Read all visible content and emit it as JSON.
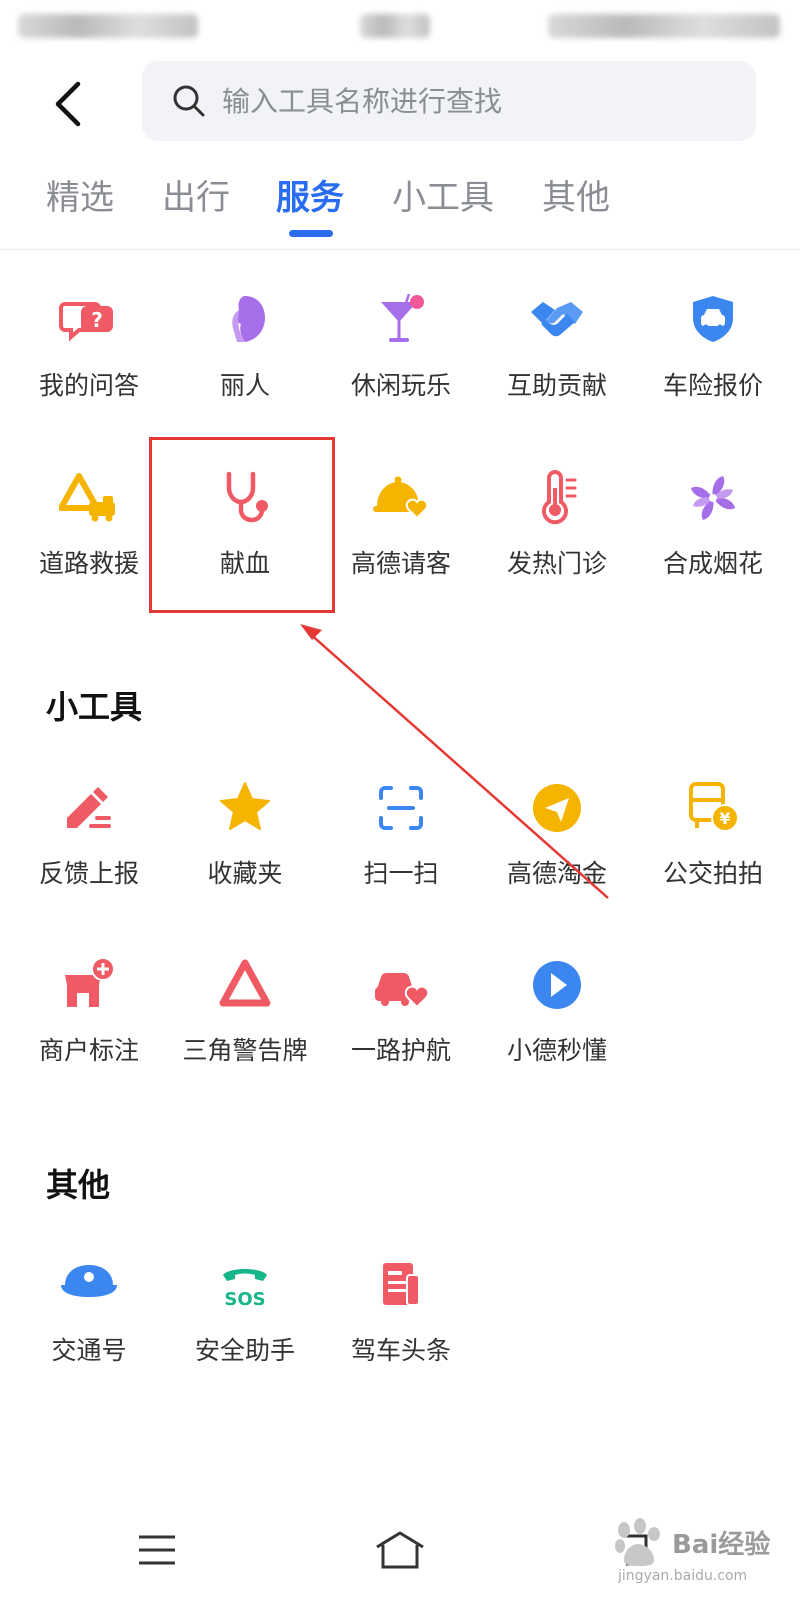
{
  "header": {
    "search_placeholder": "输入工具名称进行查找"
  },
  "tabs": [
    {
      "label": "精选"
    },
    {
      "label": "出行"
    },
    {
      "label": "服务",
      "active": true
    },
    {
      "label": "小工具"
    },
    {
      "label": "其他"
    }
  ],
  "services": [
    {
      "label": "我的问答",
      "icon": "qa-bubble-icon",
      "color": "#f05a64"
    },
    {
      "label": "丽人",
      "icon": "beauty-profile-icon",
      "color": "#a66ee8"
    },
    {
      "label": "休闲玩乐",
      "icon": "cocktail-icon",
      "color": "#a66ee8"
    },
    {
      "label": "互助贡献",
      "icon": "handshake-icon",
      "color": "#3c86f0"
    },
    {
      "label": "车险报价",
      "icon": "car-shield-icon",
      "color": "#3c86f0"
    },
    {
      "label": "道路救援",
      "icon": "roadside-rescue-icon",
      "color": "#f5b400"
    },
    {
      "label": "献血",
      "icon": "stethoscope-icon",
      "color": "#f05a64"
    },
    {
      "label": "高德请客",
      "icon": "food-cloche-heart-icon",
      "color": "#f5b400"
    },
    {
      "label": "发热门诊",
      "icon": "thermometer-icon",
      "color": "#f05a64"
    },
    {
      "label": "合成烟花",
      "icon": "pinwheel-icon",
      "color": "#a66ee8"
    }
  ],
  "tools": {
    "title": "小工具",
    "items": [
      {
        "label": "反馈上报",
        "icon": "pencil-edit-icon",
        "color": "#f05a64"
      },
      {
        "label": "收藏夹",
        "icon": "star-icon",
        "color": "#f5b400"
      },
      {
        "label": "扫一扫",
        "icon": "scan-icon",
        "color": "#3c86f0"
      },
      {
        "label": "高德淘金",
        "icon": "paper-plane-icon",
        "color": "#f5b400"
      },
      {
        "label": "公交拍拍",
        "icon": "bus-coin-icon",
        "color": "#f5b400"
      },
      {
        "label": "商户标注",
        "icon": "shop-plus-icon",
        "color": "#f05a64"
      },
      {
        "label": "三角警告牌",
        "icon": "warning-triangle-icon",
        "color": "#f05a64"
      },
      {
        "label": "一路护航",
        "icon": "car-heart-icon",
        "color": "#f05a64"
      },
      {
        "label": "小德秒懂",
        "icon": "play-circle-icon",
        "color": "#3c86f0"
      }
    ]
  },
  "others": {
    "title": "其他",
    "items": [
      {
        "label": "交通号",
        "icon": "police-cap-icon",
        "color": "#3c86f0"
      },
      {
        "label": "安全助手",
        "icon": "sos-phone-icon",
        "color": "#16b58a"
      },
      {
        "label": "驾车头条",
        "icon": "newspaper-icon",
        "color": "#f05a64"
      }
    ]
  },
  "sos_text": "SOS",
  "watermark": {
    "text": "Bai经验",
    "sub": "jingyan.baidu.com"
  }
}
